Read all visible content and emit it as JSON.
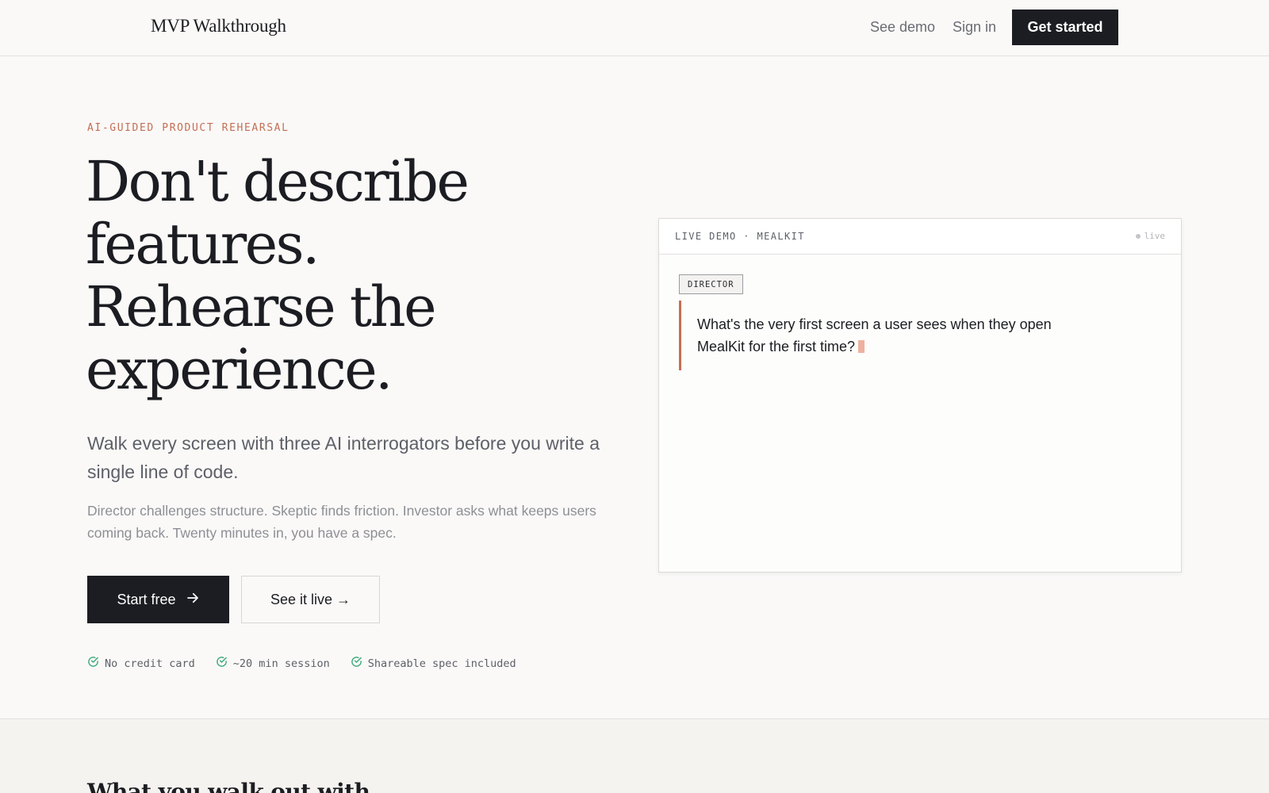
{
  "nav": {
    "brand": "MVP Walkthrough",
    "links": [
      "See demo",
      "Sign in"
    ],
    "cta": "Get started"
  },
  "hero": {
    "eyebrow": "AI-GUIDED PRODUCT REHEARSAL",
    "headline_lines": [
      "Don't describe",
      "features.",
      "Rehearse the",
      "experience."
    ],
    "subhead": "Walk every screen with three AI interrogators before you write a single line of code.",
    "body": "Director challenges structure. Skeptic finds friction. Investor asks what keeps users coming back. Twenty minutes in, you have a spec.",
    "primary_button": "Start free",
    "secondary_button": "See it live →",
    "checks": [
      "No credit card",
      "~20 min session",
      "Shareable spec included"
    ]
  },
  "demo": {
    "title": "LIVE DEMO · MEALKIT",
    "status": "live",
    "role": "DIRECTOR",
    "question": "What's the very first screen a user sees when they open MealKit for the first time?"
  },
  "next_section": {
    "title": "What you walk out with"
  },
  "colors": {
    "accent": "#c46f55",
    "check": "#3aa676",
    "dark": "#1c1d22"
  },
  "icons": {
    "arrow": "arrow-right-icon",
    "check": "check-circle-icon"
  }
}
